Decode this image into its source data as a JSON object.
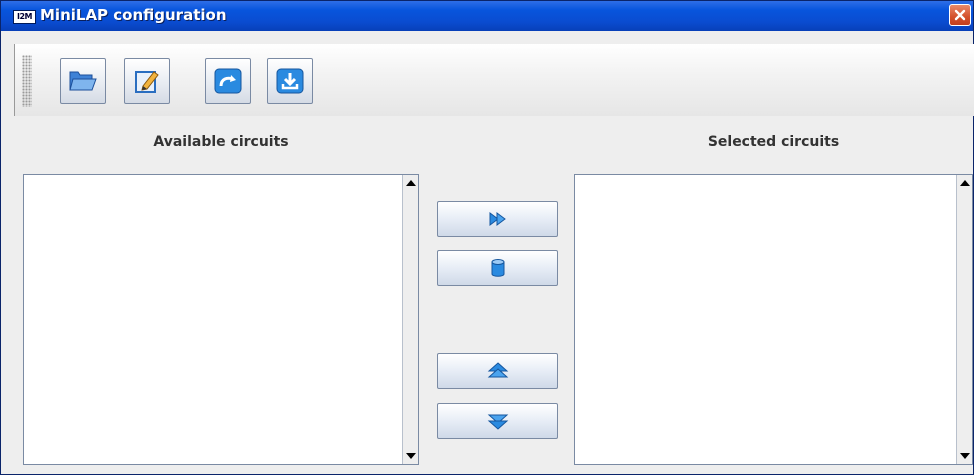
{
  "window": {
    "title": "MiniLAP configuration",
    "app_icon_text": "I2M"
  },
  "toolbar": {
    "buttons": [
      {
        "name": "open",
        "icon": "folder-open-icon"
      },
      {
        "name": "edit",
        "icon": "edit-pencil-icon"
      },
      {
        "name": "redo",
        "icon": "curved-arrow-icon"
      },
      {
        "name": "download",
        "icon": "download-tray-icon"
      }
    ]
  },
  "available": {
    "label": "Available circuits",
    "items": []
  },
  "selected": {
    "label": "Selected circuits",
    "items": []
  },
  "actions": {
    "add": {
      "icon": "double-arrow-right-icon"
    },
    "remove": {
      "icon": "database-icon"
    },
    "move_up": {
      "icon": "arrow-up-icon"
    },
    "move_down": {
      "icon": "arrow-down-icon"
    }
  },
  "colors": {
    "titlebar": "#0855dd",
    "accent_blue": "#2a8ae0",
    "close": "#d4512c"
  }
}
